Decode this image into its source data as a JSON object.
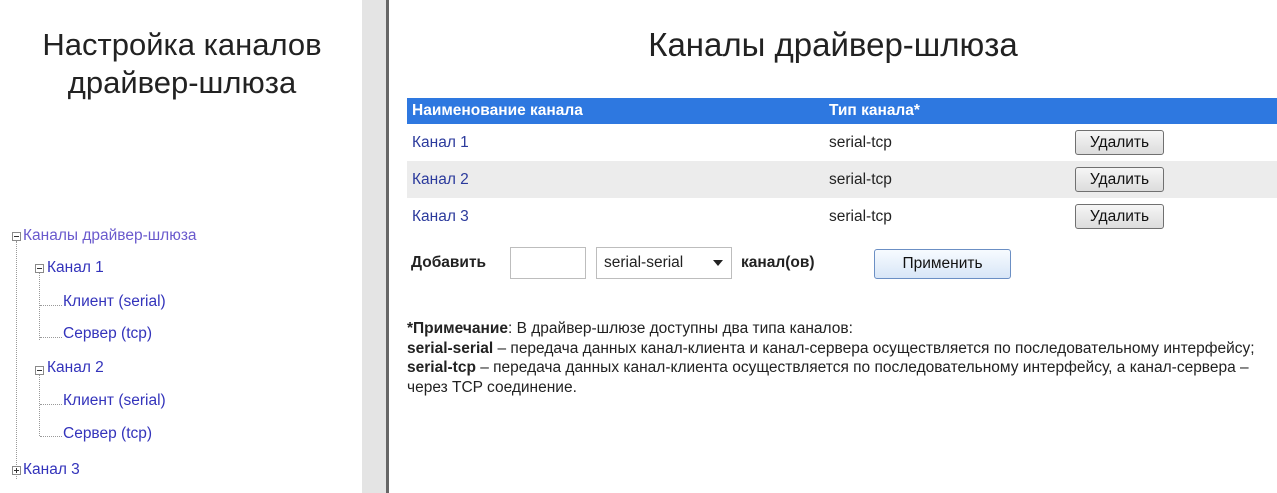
{
  "sidebar": {
    "title": "Настройка каналов драйвер-шлюза",
    "tree": {
      "root": "Каналы драйвер-шлюза",
      "channel1": {
        "label": "Канал 1",
        "client": "Клиент (serial)",
        "server": "Сервер (tcp)"
      },
      "channel2": {
        "label": "Канал 2",
        "client": "Клиент (serial)",
        "server": "Сервер (tcp)"
      },
      "channel3": {
        "label": "Канал 3"
      }
    }
  },
  "main": {
    "title": "Каналы драйвер-шлюза",
    "table": {
      "headers": [
        "Наименование канала",
        "Тип канала*",
        ""
      ],
      "rows": [
        {
          "name": "Канал 1",
          "type": "serial-tcp",
          "action": "Удалить"
        },
        {
          "name": "Канал 2",
          "type": "serial-tcp",
          "action": "Удалить"
        },
        {
          "name": "Канал 3",
          "type": "serial-tcp",
          "action": "Удалить"
        }
      ]
    },
    "add": {
      "label": "Добавить",
      "count_value": "",
      "type_selected": "serial-serial",
      "suffix": "канал(ов)",
      "apply_label": "Применить"
    },
    "note": {
      "heading": "*Примечание",
      "intro": ": В драйвер-шлюзе доступны два типа каналов:",
      "type1_name": "serial-serial",
      "type1_desc": " – передача данных канал-клиента и канал-сервера осуществляется по последовательному интерфейсу;",
      "type2_name": "serial-tcp",
      "type2_desc": " – передача данных канал-клиента осуществляется по последовательному интерфейсу, а канал-сервера – через TCP соединение."
    }
  },
  "colors": {
    "header_bg": "#2e78e0",
    "link": "#2b3a9c",
    "tree_link": "#3333bb",
    "row_alt": "#ececec",
    "splitter": "#e4e4e4"
  },
  "icons": {
    "expanded": "minus-box-icon",
    "collapsed": "plus-box-icon",
    "select": "chevron-down-icon"
  }
}
